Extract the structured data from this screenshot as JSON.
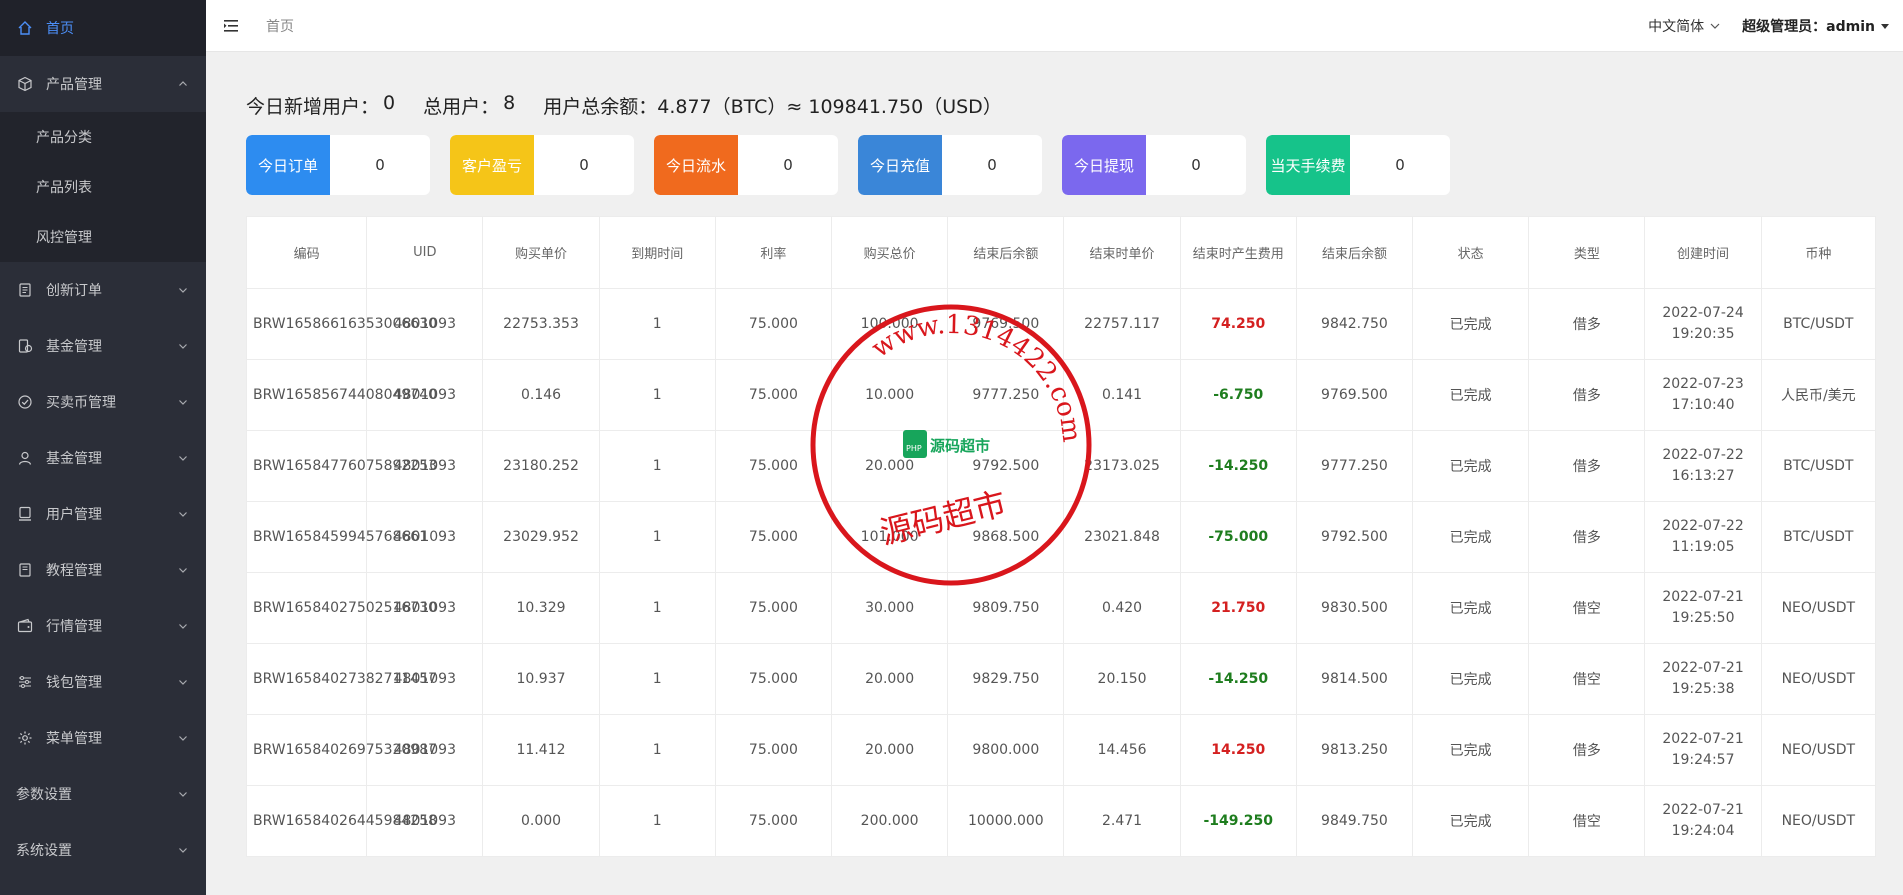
{
  "sidebar": {
    "items": [
      {
        "label": "首页",
        "icon": "home-icon",
        "active": true,
        "has_chevron": false
      },
      {
        "label": "产品管理",
        "icon": "box-icon",
        "open": true,
        "has_chevron": true
      },
      {
        "label": "创新订单",
        "icon": "doc-icon",
        "has_chevron": true
      },
      {
        "label": "基金管理",
        "icon": "fund-icon",
        "has_chevron": true
      },
      {
        "label": "买卖币管理",
        "icon": "check-circle-icon",
        "has_chevron": true
      },
      {
        "label": "基金管理",
        "icon": "user-icon",
        "has_chevron": true
      },
      {
        "label": "用户管理",
        "icon": "device-icon",
        "has_chevron": true
      },
      {
        "label": "教程管理",
        "icon": "book-icon",
        "has_chevron": true
      },
      {
        "label": "行情管理",
        "icon": "wallet-icon",
        "has_chevron": true
      },
      {
        "label": "钱包管理",
        "icon": "sliders-icon",
        "has_chevron": true
      },
      {
        "label": "菜单管理",
        "icon": "gear-icon",
        "has_chevron": true
      },
      {
        "label": "参数设置",
        "icon": "",
        "has_chevron": true
      },
      {
        "label": "系统设置",
        "icon": "",
        "has_chevron": true
      }
    ],
    "sub_items": [
      "产品分类",
      "产品列表",
      "风控管理"
    ]
  },
  "header": {
    "breadcrumb": "首页",
    "language": "中文简体",
    "user": "超级管理员：admin"
  },
  "summary": {
    "new_users_label": "今日新增用户：",
    "new_users": "0",
    "total_users_label": "总用户：",
    "total_users": "8",
    "balance_label": "用户总余额：",
    "balance": "4.877（BTC）≈ 109841.750（USD）"
  },
  "cards": [
    {
      "label": "今日订单",
      "value": "0",
      "color": "#2d8cf0"
    },
    {
      "label": "客户盈亏",
      "value": "0",
      "color": "#f5c518"
    },
    {
      "label": "今日流水",
      "value": "0",
      "color": "#f06a1e"
    },
    {
      "label": "今日充值",
      "value": "0",
      "color": "#3a86d8"
    },
    {
      "label": "今日提现",
      "value": "0",
      "color": "#7b68ee"
    },
    {
      "label": "当天手续费",
      "value": "0",
      "color": "#16c38a"
    }
  ],
  "table": {
    "headers": [
      "编码",
      "UID",
      "购买单价",
      "到期时间",
      "利率",
      "购买总价",
      "结束后余额",
      "结束时单价",
      "结束时产生费用",
      "结束后余额",
      "状态",
      "类型",
      "创建时间",
      "币种"
    ],
    "rows": [
      [
        "BRW16586616353006630",
        "4801093",
        "22753.353",
        "1",
        "75.000",
        "100.000",
        "9769.500",
        "22757.117",
        "74.250",
        "9842.750",
        "已完成",
        "借多",
        "2022-07-24 19:20:35",
        "BTC/USDT"
      ],
      [
        "BRW16585674408049740",
        "4801093",
        "0.146",
        "1",
        "75.000",
        "10.000",
        "9777.250",
        "0.141",
        "-6.750",
        "9769.500",
        "已完成",
        "借多",
        "2022-07-23 17:10:40",
        "人民币/美元"
      ],
      [
        "BRW16584776075892253",
        "4801093",
        "23180.252",
        "1",
        "75.000",
        "20.000",
        "9792.500",
        "23173.025",
        "-14.250",
        "9777.250",
        "已完成",
        "借多",
        "2022-07-22 16:13:27",
        "BTC/USDT"
      ],
      [
        "BRW1658459945768661",
        "4801093",
        "23029.952",
        "1",
        "75.000",
        "101.000",
        "9868.500",
        "23021.848",
        "-75.000",
        "9792.500",
        "已完成",
        "借多",
        "2022-07-22 11:19:05",
        "BTC/USDT"
      ],
      [
        "BRW16584027502516730",
        "4801093",
        "10.329",
        "1",
        "75.000",
        "30.000",
        "9809.750",
        "0.420",
        "21.750",
        "9830.500",
        "已完成",
        "借空",
        "2022-07-21 19:25:50",
        "NEO/USDT"
      ],
      [
        "BRW16584027382711457",
        "4801093",
        "10.937",
        "1",
        "75.000",
        "20.000",
        "9829.750",
        "20.150",
        "-14.250",
        "9814.500",
        "已完成",
        "借空",
        "2022-07-21 19:25:38",
        "NEO/USDT"
      ],
      [
        "BRW16584026975320987",
        "4801093",
        "11.412",
        "1",
        "75.000",
        "20.000",
        "9800.000",
        "14.456",
        "14.250",
        "9813.250",
        "已完成",
        "借多",
        "2022-07-21 19:24:57",
        "NEO/USDT"
      ],
      [
        "BRW16584026445984258",
        "4801093",
        "0.000",
        "1",
        "75.000",
        "200.000",
        "10000.000",
        "2.471",
        "-149.250",
        "9849.750",
        "已完成",
        "借空",
        "2022-07-21 19:24:04",
        "NEO/USDT"
      ]
    ],
    "fee_signs": [
      "positive",
      "negative",
      "negative",
      "negative",
      "positive",
      "negative",
      "positive",
      "negative"
    ]
  },
  "watermark": {
    "ring_text": "www.1314422.com",
    "center_text": "源码超市",
    "logo_text": "源码超市",
    "logo_badge": "PHP",
    "color": "#d9161c"
  }
}
